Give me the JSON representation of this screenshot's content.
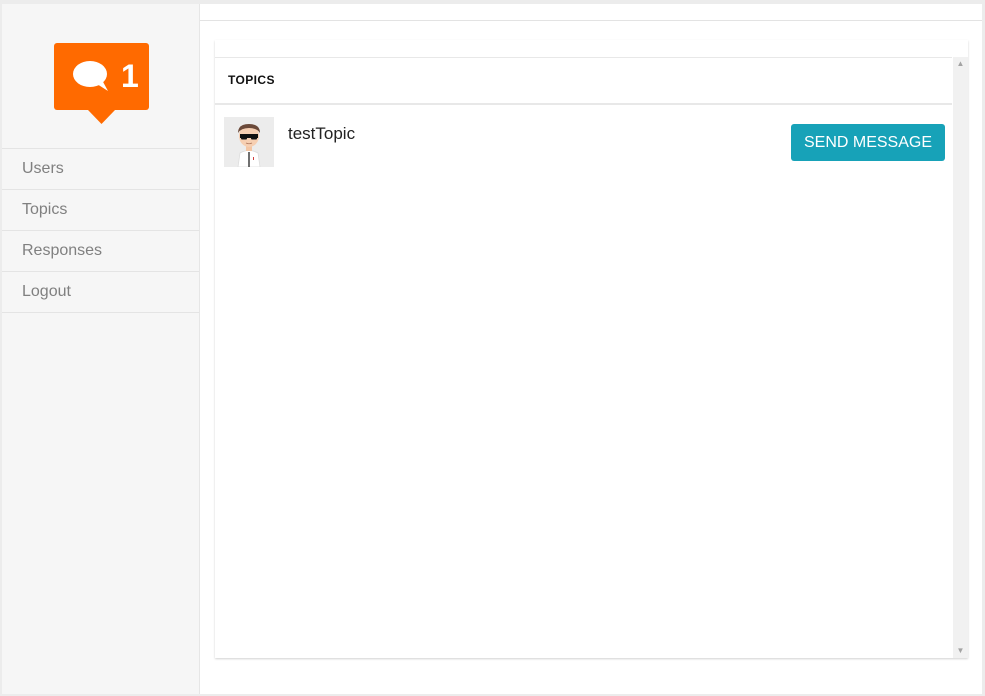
{
  "brand": {
    "logo_count": "1",
    "logo_color": "#ff6a00",
    "logo_icon": "chat-bubble-icon"
  },
  "sidebar": {
    "items": [
      {
        "label": "Users"
      },
      {
        "label": "Topics"
      },
      {
        "label": "Responses"
      },
      {
        "label": "Logout"
      }
    ]
  },
  "panel": {
    "title": "TOPICS"
  },
  "topics": [
    {
      "name": "testTopic",
      "avatar_icon": "user-avatar-icon",
      "action_label": "SEND MESSAGE"
    }
  ],
  "colors": {
    "accent": "#17a2b8",
    "sidebar_bg": "#f6f6f6"
  },
  "scrollbar": {
    "up_icon": "chevron-up-icon",
    "down_icon": "chevron-down-icon"
  }
}
